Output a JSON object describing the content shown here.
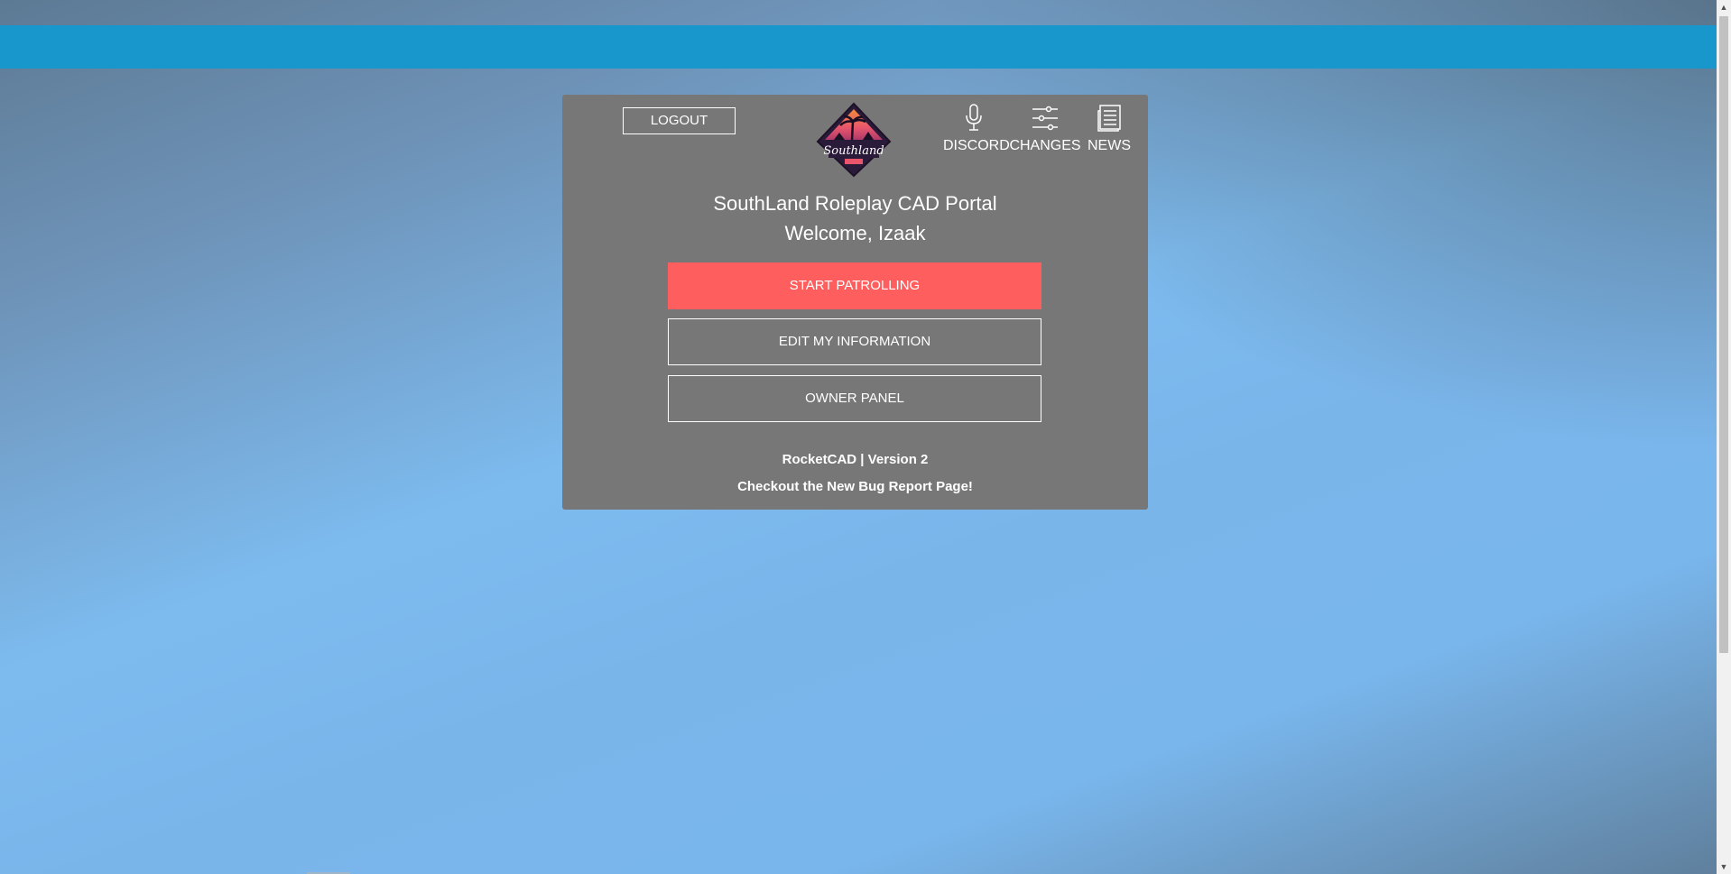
{
  "header": {
    "logout_label": "LOGOUT",
    "logo_text": "Southland",
    "nav": [
      {
        "label": "DISCORD",
        "icon": "microphone-icon"
      },
      {
        "label": "CHANGES",
        "icon": "sliders-icon"
      },
      {
        "label": "NEWS",
        "icon": "newspaper-icon"
      }
    ]
  },
  "main": {
    "portal_title": "SouthLand Roleplay CAD Portal",
    "welcome": "Welcome, Izaak",
    "buttons": {
      "start_patrolling": "START PATROLLING",
      "edit_info": "EDIT MY INFORMATION",
      "owner_panel": "OWNER PANEL"
    },
    "footer": {
      "version": "RocketCAD | Version 2",
      "bug_report": "Checkout the New Bug Report Page!"
    }
  },
  "colors": {
    "topbar": "#1797cc",
    "panel": "#777777",
    "primary_button": "#ff5e5e"
  }
}
